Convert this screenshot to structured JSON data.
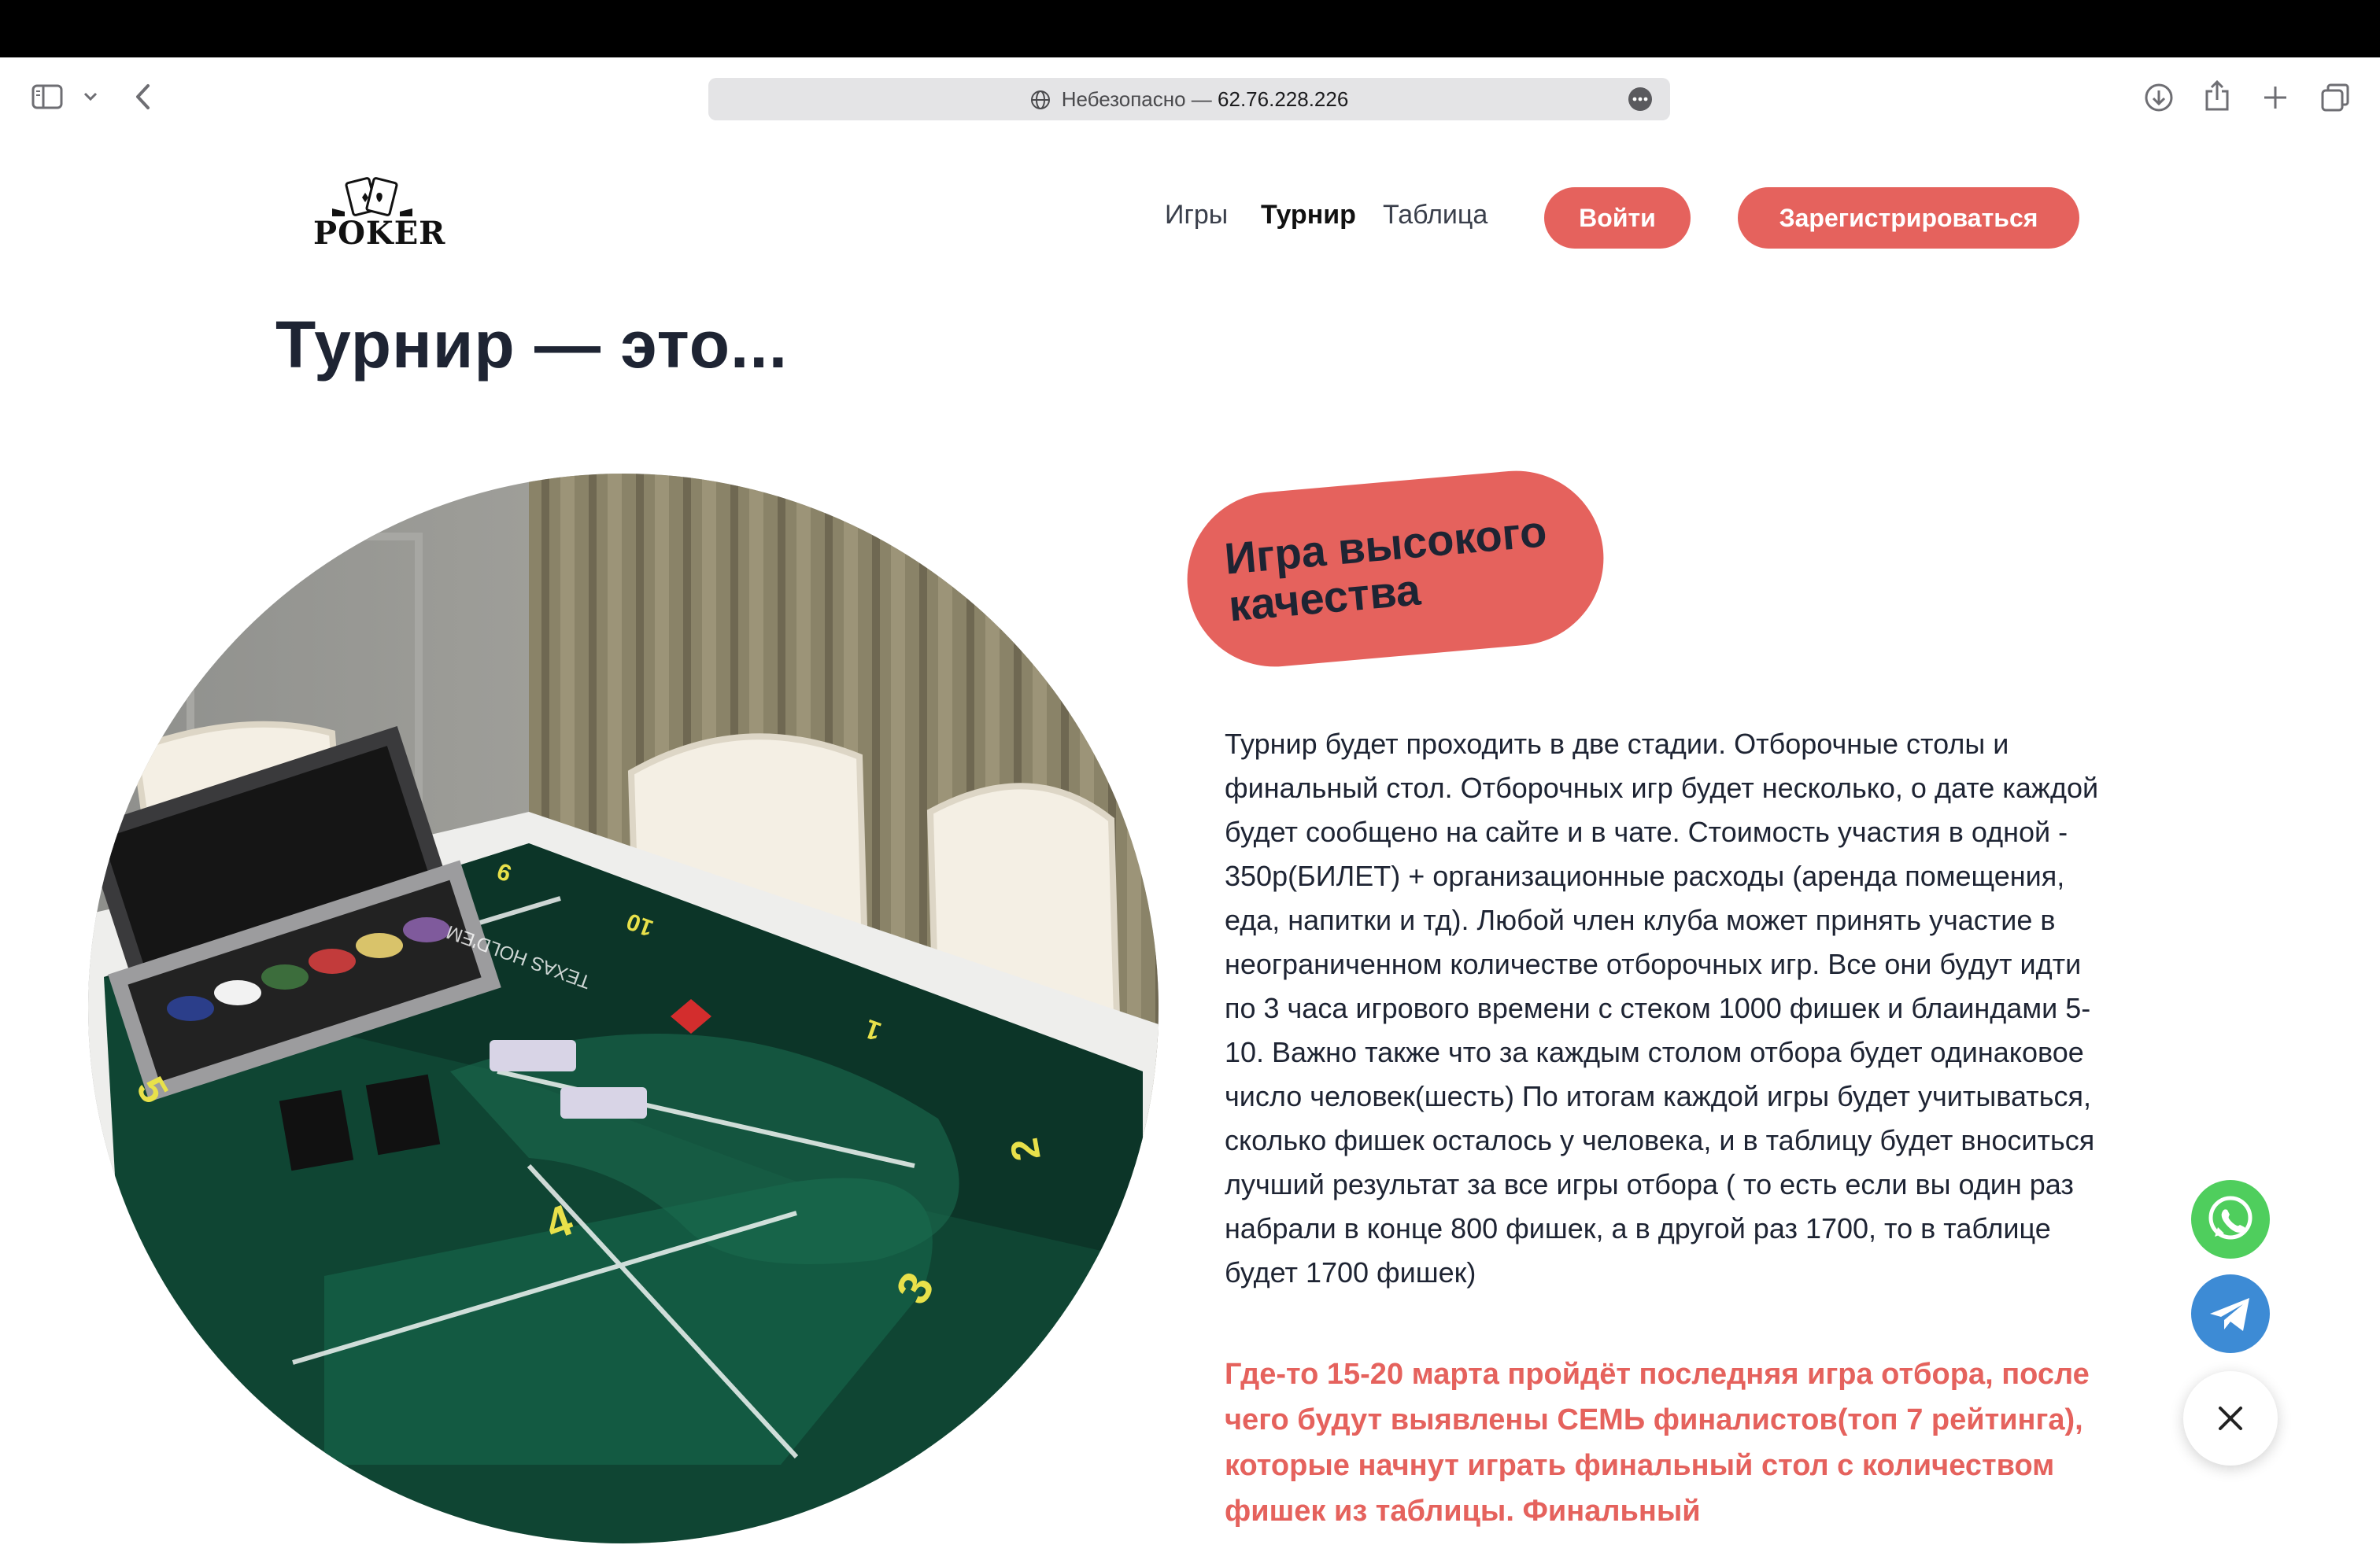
{
  "browser": {
    "url_security": "Небезопасно —",
    "url_host": "62.76.228.226",
    "icons": [
      "sidebar-icon",
      "chevron-down-icon",
      "back-icon",
      "globe-icon",
      "more-icon",
      "download-icon",
      "share-icon",
      "new-tab-icon",
      "tabs-overview-icon"
    ]
  },
  "site": {
    "logo_text": "POKER",
    "nav": [
      {
        "label": "Игры",
        "active": false
      },
      {
        "label": "Турнир",
        "active": true
      },
      {
        "label": "Таблица",
        "active": false
      }
    ],
    "login_label": "Войти",
    "register_label": "Зарегистрироваться",
    "accent_color": "#e5625d",
    "heading_color": "#1e2433"
  },
  "main": {
    "title": "Турнир — это...",
    "badge_text": "Игра высокого качества",
    "description": "Турнир будет проходить в две стадии. Отборочные столы и финальный стол. Отборочных игр будет несколько, о дате каждой будет сообщено на сайте и в чате. Стоимость участия в одной - 350р(БИЛЕТ) + организационные расходы (аренда помещения, еда, напитки и тд). Любой член клуба может принять участие в неограниченном количестве отборочных игр. Все они будут идти по 3 часа игрового времени с стеком 1000 фишек и блаиндами 5-10. Важно также что за каждым столом отбора будет одинаковое число человек(шесть) По итогам каждой игры будет учитываться, сколько фишек осталось у человека, и в таблицу будет вноситься лучший результат за все игры отбора ( то есть если вы один раз набрали в конце 800 фишек, а в другой раз 1700, то в таблице будет 1700 фишек)",
    "highlight": "Где-то 15-20 марта пройдёт последняя игра отбора, после чего будут выявлены СЕМЬ финалистов(топ 7 рейтинга), которые начнут играть финальный стол с количеством фишек из таблицы. Финальный",
    "table_numbers": [
      "9",
      "10",
      "1",
      "2",
      "3",
      "4",
      "5"
    ],
    "table_print": "TEXAS HOLD'EM"
  },
  "floating": {
    "whatsapp_color": "#4fce5d",
    "telegram_color": "#3d8bd5"
  }
}
